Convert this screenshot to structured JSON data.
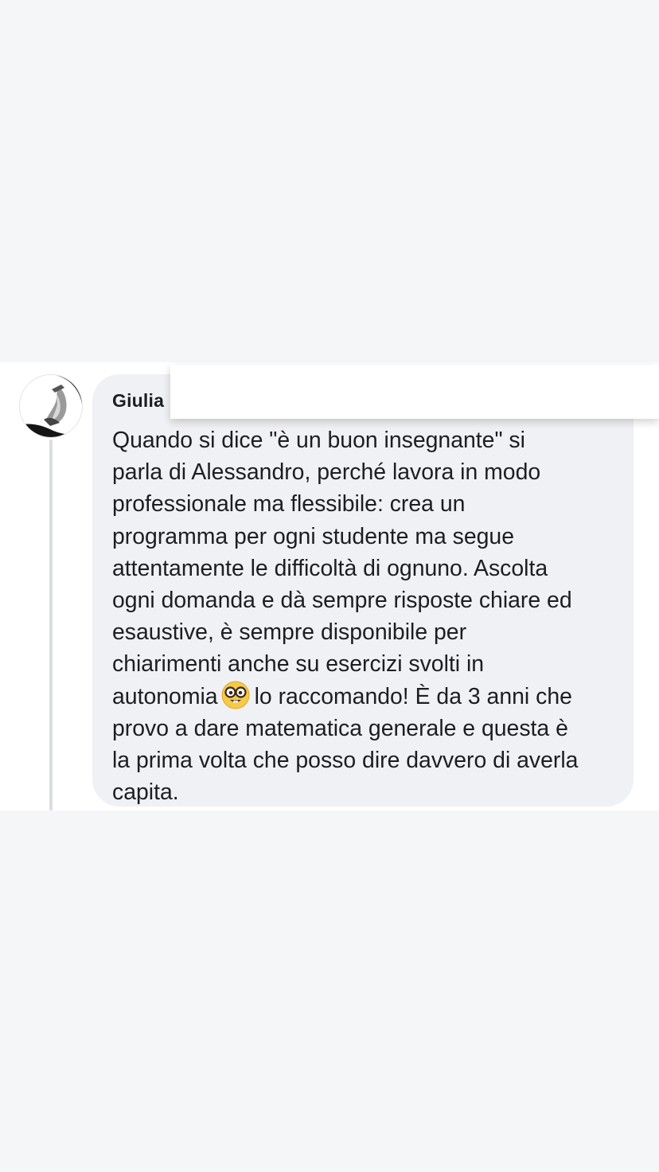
{
  "comment": {
    "author": "Giulia",
    "text_lines_before_emoji": [
      "Quando si dice \"è un buon insegnante\" si",
      "parla di Alessandro, perché lavora in modo",
      "professionale ma flessibile: crea un",
      "programma per ogni studente ma segue",
      "attentamente le difficoltà di ognuno. Ascolta",
      "ogni domanda e dà sempre risposte chiare ed",
      "esaustive, è sempre disponibile per",
      "chiarimenti anche su esercizi svolti in"
    ],
    "emoji_line_start": "autonomia",
    "emoji": "nerd-face-emoji",
    "emoji_line_end": "lo raccomando! È da 3 anni che",
    "text_lines_after_emoji": [
      "provo a dare matematica generale e questa è",
      "la prima volta che posso dire davvero di averla",
      "capita."
    ]
  },
  "colors": {
    "page_background": "#f5f6f8",
    "bubble_background": "#f0f1f4",
    "text": "#1c1e21",
    "thread_line": "#dcdde0"
  }
}
